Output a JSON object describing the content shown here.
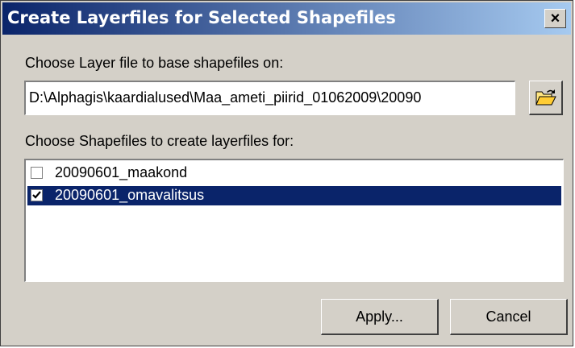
{
  "window": {
    "title": "Create Layerfiles for Selected Shapefiles",
    "close_label": "×"
  },
  "layer_file": {
    "label": "Choose Layer file to base shapefiles on:",
    "path": "D:\\Alphagis\\kaardialused\\Maa_ameti_piirid_01062009\\20090",
    "browse_icon": "open-folder-icon"
  },
  "shapefiles": {
    "label": "Choose Shapefiles to create layerfiles for:",
    "items": [
      {
        "name": "20090601_maakond",
        "checked": false,
        "selected": false
      },
      {
        "name": "20090601_omavalitsus",
        "checked": true,
        "selected": true
      }
    ]
  },
  "buttons": {
    "apply": "Apply...",
    "cancel": "Cancel"
  },
  "colors": {
    "title_gradient_start": "#0a246a",
    "title_gradient_end": "#a6caf0",
    "selection": "#0a246a",
    "face": "#d4d0c8"
  }
}
